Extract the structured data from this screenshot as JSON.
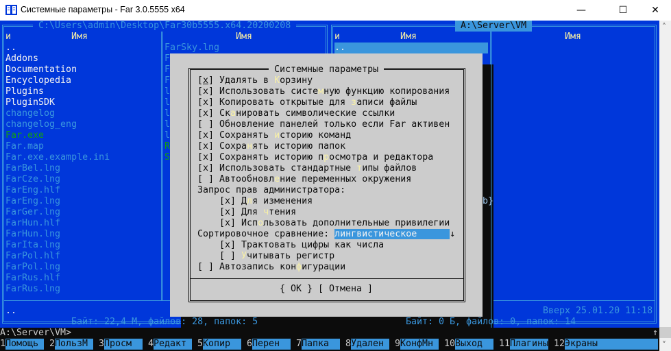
{
  "window": {
    "title": "Системные параметры - Far 3.0.5555 x64",
    "icon": "far-manager-icon",
    "controls": {
      "minimize": "—",
      "maximize": "☐",
      "close": "✕"
    }
  },
  "colors": {
    "panel_bg": "#0037da",
    "accent": "#3a96dd",
    "dialog_bg": "#cccccc",
    "hotkey": "#f9f1a5",
    "exe": "#13a10e"
  },
  "left_panel": {
    "path": " C:\\Users\\admin\\Desktop\\Far30b5555.x64.20200208 ",
    "col_header_1": "и",
    "col_header_2": "Имя",
    "col_header_3": "Имя",
    "files": [
      {
        "name": "..",
        "kind": "dir"
      },
      {
        "name": "Addons",
        "kind": "dir"
      },
      {
        "name": "Documentation",
        "kind": "dir"
      },
      {
        "name": "Encyclopedia",
        "kind": "dir"
      },
      {
        "name": "Plugins",
        "kind": "dir"
      },
      {
        "name": "PluginSDK",
        "kind": "dir"
      },
      {
        "name": "changelog",
        "kind": "file"
      },
      {
        "name": "changelog_eng",
        "kind": "file"
      },
      {
        "name": "Far.exe",
        "kind": "exe"
      },
      {
        "name": "Far.map",
        "kind": "file"
      },
      {
        "name": "Far.exe.example.ini",
        "kind": "file"
      },
      {
        "name": "FarBel.lng",
        "kind": "file"
      },
      {
        "name": "FarCze.lng",
        "kind": "file"
      },
      {
        "name": "FarEng.hlf",
        "kind": "file"
      },
      {
        "name": "FarEng.lng",
        "kind": "file"
      },
      {
        "name": "FarGer.lng",
        "kind": "file"
      },
      {
        "name": "FarHun.hlf",
        "kind": "file"
      },
      {
        "name": "FarHun.lng",
        "kind": "file"
      },
      {
        "name": "FarIta.lng",
        "kind": "file"
      },
      {
        "name": "FarPol.hlf",
        "kind": "file"
      },
      {
        "name": "FarPol.lng",
        "kind": "file"
      },
      {
        "name": "FarRus.hlf",
        "kind": "file"
      },
      {
        "name": "FarRus.lng",
        "kind": "file"
      }
    ],
    "files_col2": [
      {
        "name": "FarSky.lng",
        "kind": "file"
      },
      {
        "name": "F",
        "kind": "file"
      },
      {
        "name": "F",
        "kind": "file"
      },
      {
        "name": "F",
        "kind": "file"
      },
      {
        "name": "l",
        "kind": "file"
      },
      {
        "name": "l",
        "kind": "file"
      },
      {
        "name": "l",
        "kind": "file"
      },
      {
        "name": "l",
        "kind": "file"
      },
      {
        "name": "l",
        "kind": "file"
      },
      {
        "name": "R",
        "kind": "exe"
      },
      {
        "name": "S",
        "kind": "exe"
      }
    ],
    "info": "..",
    "status": " Байт: 22,4 М, файлов: 28, папок: 5 "
  },
  "right_panel": {
    "path": " A:\\Server\\VM ",
    "col_header_1": "и",
    "col_header_2": "Имя",
    "col_header_3": "Имя",
    "selected_item": "..",
    "shadow_text": "b}",
    "info": "Вверх 25.01.20 11:18",
    "status": " Байт: 0 Б, файлов: 0, папок: 14 "
  },
  "dialog": {
    "title": " Системные параметры ",
    "items": [
      {
        "type": "checkbox",
        "checked": true,
        "pre": "Удалять в ",
        "hot": "К",
        "post": "орзину",
        "indent": 0
      },
      {
        "type": "checkbox",
        "checked": true,
        "pre": "Использовать систе",
        "hot": "м",
        "post": "ную функцию копирования",
        "indent": 0
      },
      {
        "type": "checkbox",
        "checked": true,
        "pre": "Копировать открытые для ",
        "hot": "з",
        "post": "аписи файлы",
        "indent": 0
      },
      {
        "type": "checkbox",
        "checked": true,
        "pre": "Ск",
        "hot": "а",
        "post": "нировать символические ссылки",
        "indent": 0
      },
      {
        "type": "checkbox",
        "checked": false,
        "pre": "Обновление панелей только если Far активен",
        "hot": "",
        "post": "",
        "indent": 0
      },
      {
        "type": "checkbox",
        "checked": true,
        "pre": "Сохранять ",
        "hot": "и",
        "post": "сторию команд",
        "indent": 0
      },
      {
        "type": "checkbox",
        "checked": true,
        "pre": "Сохра",
        "hot": "н",
        "post": "ять историю папок",
        "indent": 0
      },
      {
        "type": "checkbox",
        "checked": true,
        "pre": "Сохранять историю п",
        "hot": "р",
        "post": "осмотра и редактора",
        "indent": 0
      },
      {
        "type": "checkbox",
        "checked": true,
        "pre": "Использовать стандартные ",
        "hot": "т",
        "post": "ипы файлов",
        "indent": 0
      },
      {
        "type": "checkbox",
        "checked": false,
        "pre": "Автообновл",
        "hot": "е",
        "post": "ние переменных окружения",
        "indent": 0
      },
      {
        "type": "label",
        "pre": "Запрос прав администратора:",
        "hot": "",
        "post": "",
        "indent": 0
      },
      {
        "type": "checkbox",
        "checked": true,
        "pre": "Д",
        "hot": "л",
        "post": "я изменения",
        "indent": 4
      },
      {
        "type": "checkbox",
        "checked": true,
        "pre": "Для ",
        "hot": "ч",
        "post": "тения",
        "indent": 4
      },
      {
        "type": "checkbox",
        "checked": true,
        "pre": "Исп",
        "hot": "о",
        "post": "льзовать дополнительные привилегии",
        "indent": 4
      },
      {
        "type": "combo",
        "pre": "Сортировочное сравнение: ",
        "hot": "",
        "post": "",
        "value": "лингвистическое      ",
        "arrow": "↓",
        "indent": 0
      },
      {
        "type": "checkbox",
        "checked": true,
        "pre": "Трактовать цифры как числа",
        "hot": "",
        "post": "",
        "indent": 4
      },
      {
        "type": "checkbox",
        "checked": false,
        "pre": "",
        "hot": "У",
        "post": "читывать регистр",
        "indent": 4
      },
      {
        "type": "checkbox",
        "checked": false,
        "pre": "Автозапись кон",
        "hot": "ф",
        "post": "игурации",
        "indent": 0
      }
    ],
    "ok_label": "{ OK }",
    "cancel_label": "[ Отмена ]"
  },
  "command_line": {
    "prompt": "A:\\Server\\VM>",
    "scroll_indicator": "↑"
  },
  "keybar": [
    {
      "num": "1",
      "label": "Помощь"
    },
    {
      "num": "2",
      "label": "ПользМ"
    },
    {
      "num": "3",
      "label": "Просм"
    },
    {
      "num": "4",
      "label": "Редакт"
    },
    {
      "num": "5",
      "label": "Копир"
    },
    {
      "num": "6",
      "label": "Перен"
    },
    {
      "num": "7",
      "label": "Папка"
    },
    {
      "num": "8",
      "label": "Удален"
    },
    {
      "num": "9",
      "label": "КонфМн"
    },
    {
      "num": "10",
      "label": "Выход"
    },
    {
      "num": "11",
      "label": "Плагины"
    },
    {
      "num": "12",
      "label": "Экраны"
    }
  ],
  "scrollbar": {
    "up": "˄",
    "down": "˅"
  }
}
